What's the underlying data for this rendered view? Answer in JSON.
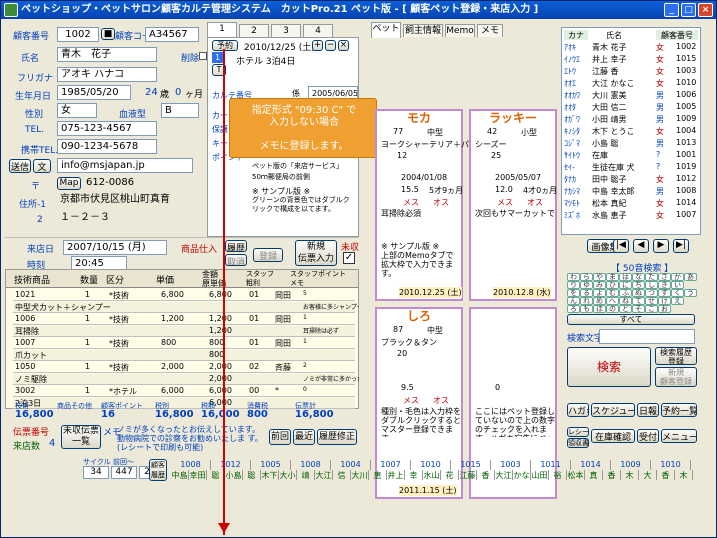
{
  "window": {
    "title": "ペットショップ・ペットサロン顧客カルテ管理システム　カットPro.21 ペット版 - [ 顧客ペット登録・来店入力 ]",
    "minimize": "_",
    "maximize": "□",
    "close": "×"
  },
  "customer": {
    "id_label": "顧客番号",
    "id": "1002",
    "code_label": "顧客コード",
    "code": "A34567",
    "name_label": "氏名",
    "name": "青木　花子",
    "delete_label": "削除",
    "furigana_label": "フリガナ",
    "furigana": "アオキ ハナコ",
    "birthday_label": "生年月日",
    "birthday": "1985/05/20",
    "age": "24",
    "age_unit": "歳",
    "months": "0",
    "months_unit": "ヶ月",
    "gender_label": "性別",
    "gender": "女",
    "blood_label": "血液型",
    "blood": "B",
    "tel_label": "TEL.",
    "tel": "075-123-4567",
    "mobile_label": "携帯TEL.",
    "mobile": "090-1234-5678",
    "mail_btn1": "送信",
    "mail_btn2": "文",
    "mail": "info@msjapan.jp",
    "map_btn": "Map",
    "zip_label": "〒",
    "zip": "612-0086",
    "addr1_label": "住所-1",
    "addr1": "京都市伏見区桃山町真育",
    "addr2_label": "2",
    "addr2": "１－２－３"
  },
  "visit": {
    "date_label": "来店日",
    "date": "2007/10/15 (月)",
    "time_label": "時刻",
    "time": "20:45",
    "product_label": "商品仕入",
    "history_btn": "履歴",
    "cancel_btn": "取消",
    "register_btn": "登録",
    "new_slip_btn": "新規\n伝票入力",
    "unsettled_label": "未収"
  },
  "grid": {
    "headers": [
      "技術商品",
      "数量",
      "区分",
      "単価",
      "金額\n原単価",
      "スタッフ\n粗利",
      "スタッフポイント\nメモ"
    ],
    "rows": [
      {
        "code": "1021",
        "qty": "1",
        "kind": "*技術",
        "price": "6,800",
        "amount": "6,800",
        "staff": "01",
        "staff_name": "岡田",
        "memo": "5"
      },
      {
        "code": "中型犬カット＋シャンプー",
        "qty": "",
        "kind": "",
        "price": "",
        "amount": "",
        "staff": "",
        "staff_name": "",
        "memo": "お客様に多シャンプーを勧め"
      },
      {
        "code": "1006",
        "qty": "1",
        "kind": "*技術",
        "price": "1,200",
        "amount": "1,200",
        "staff": "01",
        "staff_name": "岡田",
        "memo": "1"
      },
      {
        "code": "耳掃除",
        "qty": "",
        "kind": "",
        "price": "",
        "amount": "1,200",
        "staff": "",
        "staff_name": "",
        "memo": "耳掃除は必ず"
      },
      {
        "code": "1007",
        "qty": "1",
        "kind": "*技術",
        "price": "800",
        "amount": "800",
        "staff": "01",
        "staff_name": "岡田",
        "memo": "1"
      },
      {
        "code": "爪カット",
        "qty": "",
        "kind": "",
        "price": "",
        "amount": "800",
        "staff": "",
        "staff_name": "",
        "memo": ""
      },
      {
        "code": "1050",
        "qty": "1",
        "kind": "*技術",
        "price": "2,000",
        "amount": "2,000",
        "staff": "02",
        "staff_name": "斉藤",
        "memo": "2"
      },
      {
        "code": "ノミ駆除",
        "qty": "",
        "kind": "",
        "price": "",
        "amount": "2,000",
        "staff": "",
        "staff_name": "",
        "memo": "ノミが非常に多かった"
      },
      {
        "code": "3002",
        "qty": "1",
        "kind": "*ホテル",
        "price": "6,000",
        "amount": "6,000",
        "staff": "00",
        "staff_name": "*",
        "memo": "0"
      },
      {
        "code": "2泊3日",
        "qty": "",
        "kind": "",
        "price": "",
        "amount": "6,000",
        "staff": "",
        "staff_name": "",
        "memo": ""
      }
    ],
    "totals_labels": [
      "技術",
      "商品その他",
      "顧客ポイント",
      "税別",
      "税額",
      "消費税",
      "伝票計"
    ],
    "totals": [
      "16,800",
      "",
      "16",
      "16,800",
      "16,000",
      "800",
      "16,800"
    ],
    "slip_label": "伝票番号",
    "slip_btn": "未収伝票\n一覧",
    "memo_label": "メモ",
    "memo_text": "ノミが多くなったとお伝えしています。動物病院での診察をお勧めいたしま す。(レシートで印刷も可能)",
    "visits_label": "来店数",
    "visits": "4",
    "prev_btn": "前回",
    "recent_btn": "最近",
    "fix_btn": "履歴修正"
  },
  "tabs": [
    "1",
    "2",
    "3",
    "4"
  ],
  "reserve": {
    "label": "予約",
    "date": "2010/12/25 (土)",
    "text": "ホテル 3泊4日",
    "callout": "指定形式 \"09:30 C\" で\n入力しない場合\n\nメモに登録します。",
    "side_labels": [
      "カルテ番号",
      "カード",
      "保護",
      "キーワード",
      "ポイント"
    ],
    "kakari_label": "係",
    "kakari_date": "2005/06/05",
    "note1": "ペット版の「来店サービス」",
    "note2": "50ｍ郵便局の前側",
    "sample_title": "※ サンプル版 ※",
    "sample_text": "グリーンの背景色ではダブルクリックで構成を以てます。"
  },
  "pet_tabs": [
    "ペット",
    "飼主情報",
    "Memo",
    "メモ"
  ],
  "pets": [
    {
      "name": "モカ",
      "size": "中型",
      "type": "77",
      "breed": "ヨークシャーテリア＋パピヨン",
      "color": "12",
      "born": "2004/01/08",
      "weight": "15.5",
      "age": "5才9ヵ月",
      "gender": "メス",
      "fix": "オス",
      "memo": "耳掃除必須",
      "sample": "※ サンプル版 ※",
      "sample_memo": "上部のMemoタブで拡大枠で入力できます。",
      "reserve": "2010.12.25 (土)"
    },
    {
      "name": "ラッキー",
      "size": "小型",
      "type": "42",
      "breed": "シーズー",
      "color": "25",
      "born": "2005/05/07",
      "weight": "12.0",
      "age": "4才0ヵ月",
      "gender": "メス",
      "fix": "オス",
      "memo": "次回もサマーカットで",
      "reserve": "2010.12.8 (水)"
    },
    {
      "name": "しろ",
      "size": "中型",
      "type": "87",
      "breed": "ブラック＆タン",
      "color": "20",
      "born": "",
      "weight": "9.5",
      "age": "",
      "gender": "メス",
      "fix": "オス",
      "memo": "種別・毛色は入力枠をダブルクリックするとマスター登録できます。",
      "reserve": "2011.1.15 (土)"
    },
    {
      "name": "",
      "size": "",
      "type": "",
      "breed": "",
      "color": "",
      "born": "",
      "weight": "0",
      "age": "",
      "gender": "",
      "fix": "",
      "memo": "ここにはペット登録していないので上の数字のチェックを入れます。ハガキ宛先にペット名表示しません。",
      "reserve": ""
    }
  ],
  "list": {
    "headers": [
      "カナ",
      "氏名",
      "顧客番号"
    ],
    "rows": [
      {
        "kana": "ｱｵｷ",
        "name": "青木 花子",
        "sex": "女",
        "id": "1002"
      },
      {
        "kana": "ｲﾉｳｴ",
        "name": "井上 幸子",
        "sex": "女",
        "id": "1015"
      },
      {
        "kana": "ｴﾄｳ",
        "name": "江藤 香",
        "sex": "女",
        "id": "1003"
      },
      {
        "kana": "ｵｵｴ",
        "name": "大江 かなこ",
        "sex": "女",
        "id": "1010"
      },
      {
        "kana": "ｵｵｶﾜ",
        "name": "大川 憲美",
        "sex": "男",
        "id": "1006"
      },
      {
        "kana": "ｵｵﾀ",
        "name": "大田 信二",
        "sex": "男",
        "id": "1005"
      },
      {
        "kana": "ｵｶﾞﾜ",
        "name": "小田 靖男",
        "sex": "男",
        "id": "1009"
      },
      {
        "kana": "ｷﾉｼﾀ",
        "name": "木下 とうこ",
        "sex": "女",
        "id": "1004"
      },
      {
        "kana": "ｺｼﾞﾏ",
        "name": "小島 聡",
        "sex": "男",
        "id": "1013"
      },
      {
        "kana": "ｻｲﾄｳ",
        "name": "在庫",
        "sex": "?",
        "id": "1001"
      },
      {
        "kana": "ｾｲ-",
        "name": "生徒在庫 犬",
        "sex": "?",
        "id": "1019"
      },
      {
        "kana": "ﾀﾅｶ",
        "name": "田中 聡子",
        "sex": "女",
        "id": "1012"
      },
      {
        "kana": "ﾅｶｼﾏ",
        "name": "中島 幸太郎",
        "sex": "男",
        "id": "1008"
      },
      {
        "kana": "ﾏﾂﾓﾄ",
        "name": "松本 真紀",
        "sex": "女",
        "id": "1014"
      },
      {
        "kana": "ﾐｽﾞﾎ",
        "name": "水島 恵子",
        "sex": "女",
        "id": "1007"
      }
    ],
    "image_btn": "画像集",
    "kana_title": "【 50音検索 】",
    "kana_rows": [
      [
        "わ",
        "ら",
        "や",
        "ま",
        "は",
        "な",
        "た",
        "さ",
        "か",
        "あ"
      ],
      [
        "り",
        "ゆ",
        "み",
        "ひ",
        "に",
        "ち",
        "し",
        "き",
        "い"
      ],
      [
        "を",
        "る",
        "よ",
        "む",
        "ふ",
        "ぬ",
        "つ",
        "す",
        "く",
        "う"
      ],
      [
        "ん",
        "れ",
        "め",
        "へ",
        "ね",
        "て",
        "せ",
        "け",
        "え"
      ],
      [
        "ろ",
        "も",
        "ほ",
        "の",
        "と",
        "そ",
        "こ",
        "お"
      ]
    ],
    "all_label": "すべて",
    "search_label": "検索文字",
    "search_btn": "検索",
    "search_reg_btn": "検索履歴\n登録",
    "new_search_btn": "新規\n顧客登録",
    "bottom_btns": [
      "ハガキ",
      "スケジュール",
      "日報",
      "予約一覧",
      "レシート",
      "在庫確認",
      "受付",
      "メニュー"
    ],
    "receipt2": "領収書"
  },
  "cycle": {
    "label1": "サイクル",
    "value1": "34",
    "label2": "前回〜",
    "value2": "447",
    "label3": "2",
    "btn": "顧客\n履歴",
    "numbers": [
      "1008",
      "1012",
      "1005",
      "1008",
      "1004",
      "1007",
      "1010",
      "1015",
      "1003",
      "1011",
      "1014",
      "1009",
      "1010"
    ],
    "names": [
      "中島",
      "幸田中",
      "聡",
      "小島",
      "聡",
      "木下",
      "大小田",
      "靖",
      "大江",
      "信",
      "大川",
      "恵",
      "井上",
      "幸",
      "水山田",
      "花",
      "江藤",
      "香",
      "大江",
      "かな",
      "山田",
      "裕",
      "松本",
      "真",
      "香",
      "木",
      "大",
      "香",
      "木"
    ]
  },
  "colors": {
    "accent_blue": "#0a5fd8",
    "panel": "#ece9d8",
    "pet_border": "#c48ad0",
    "callout": "#f0a030",
    "red_arrow": "#d00000"
  }
}
